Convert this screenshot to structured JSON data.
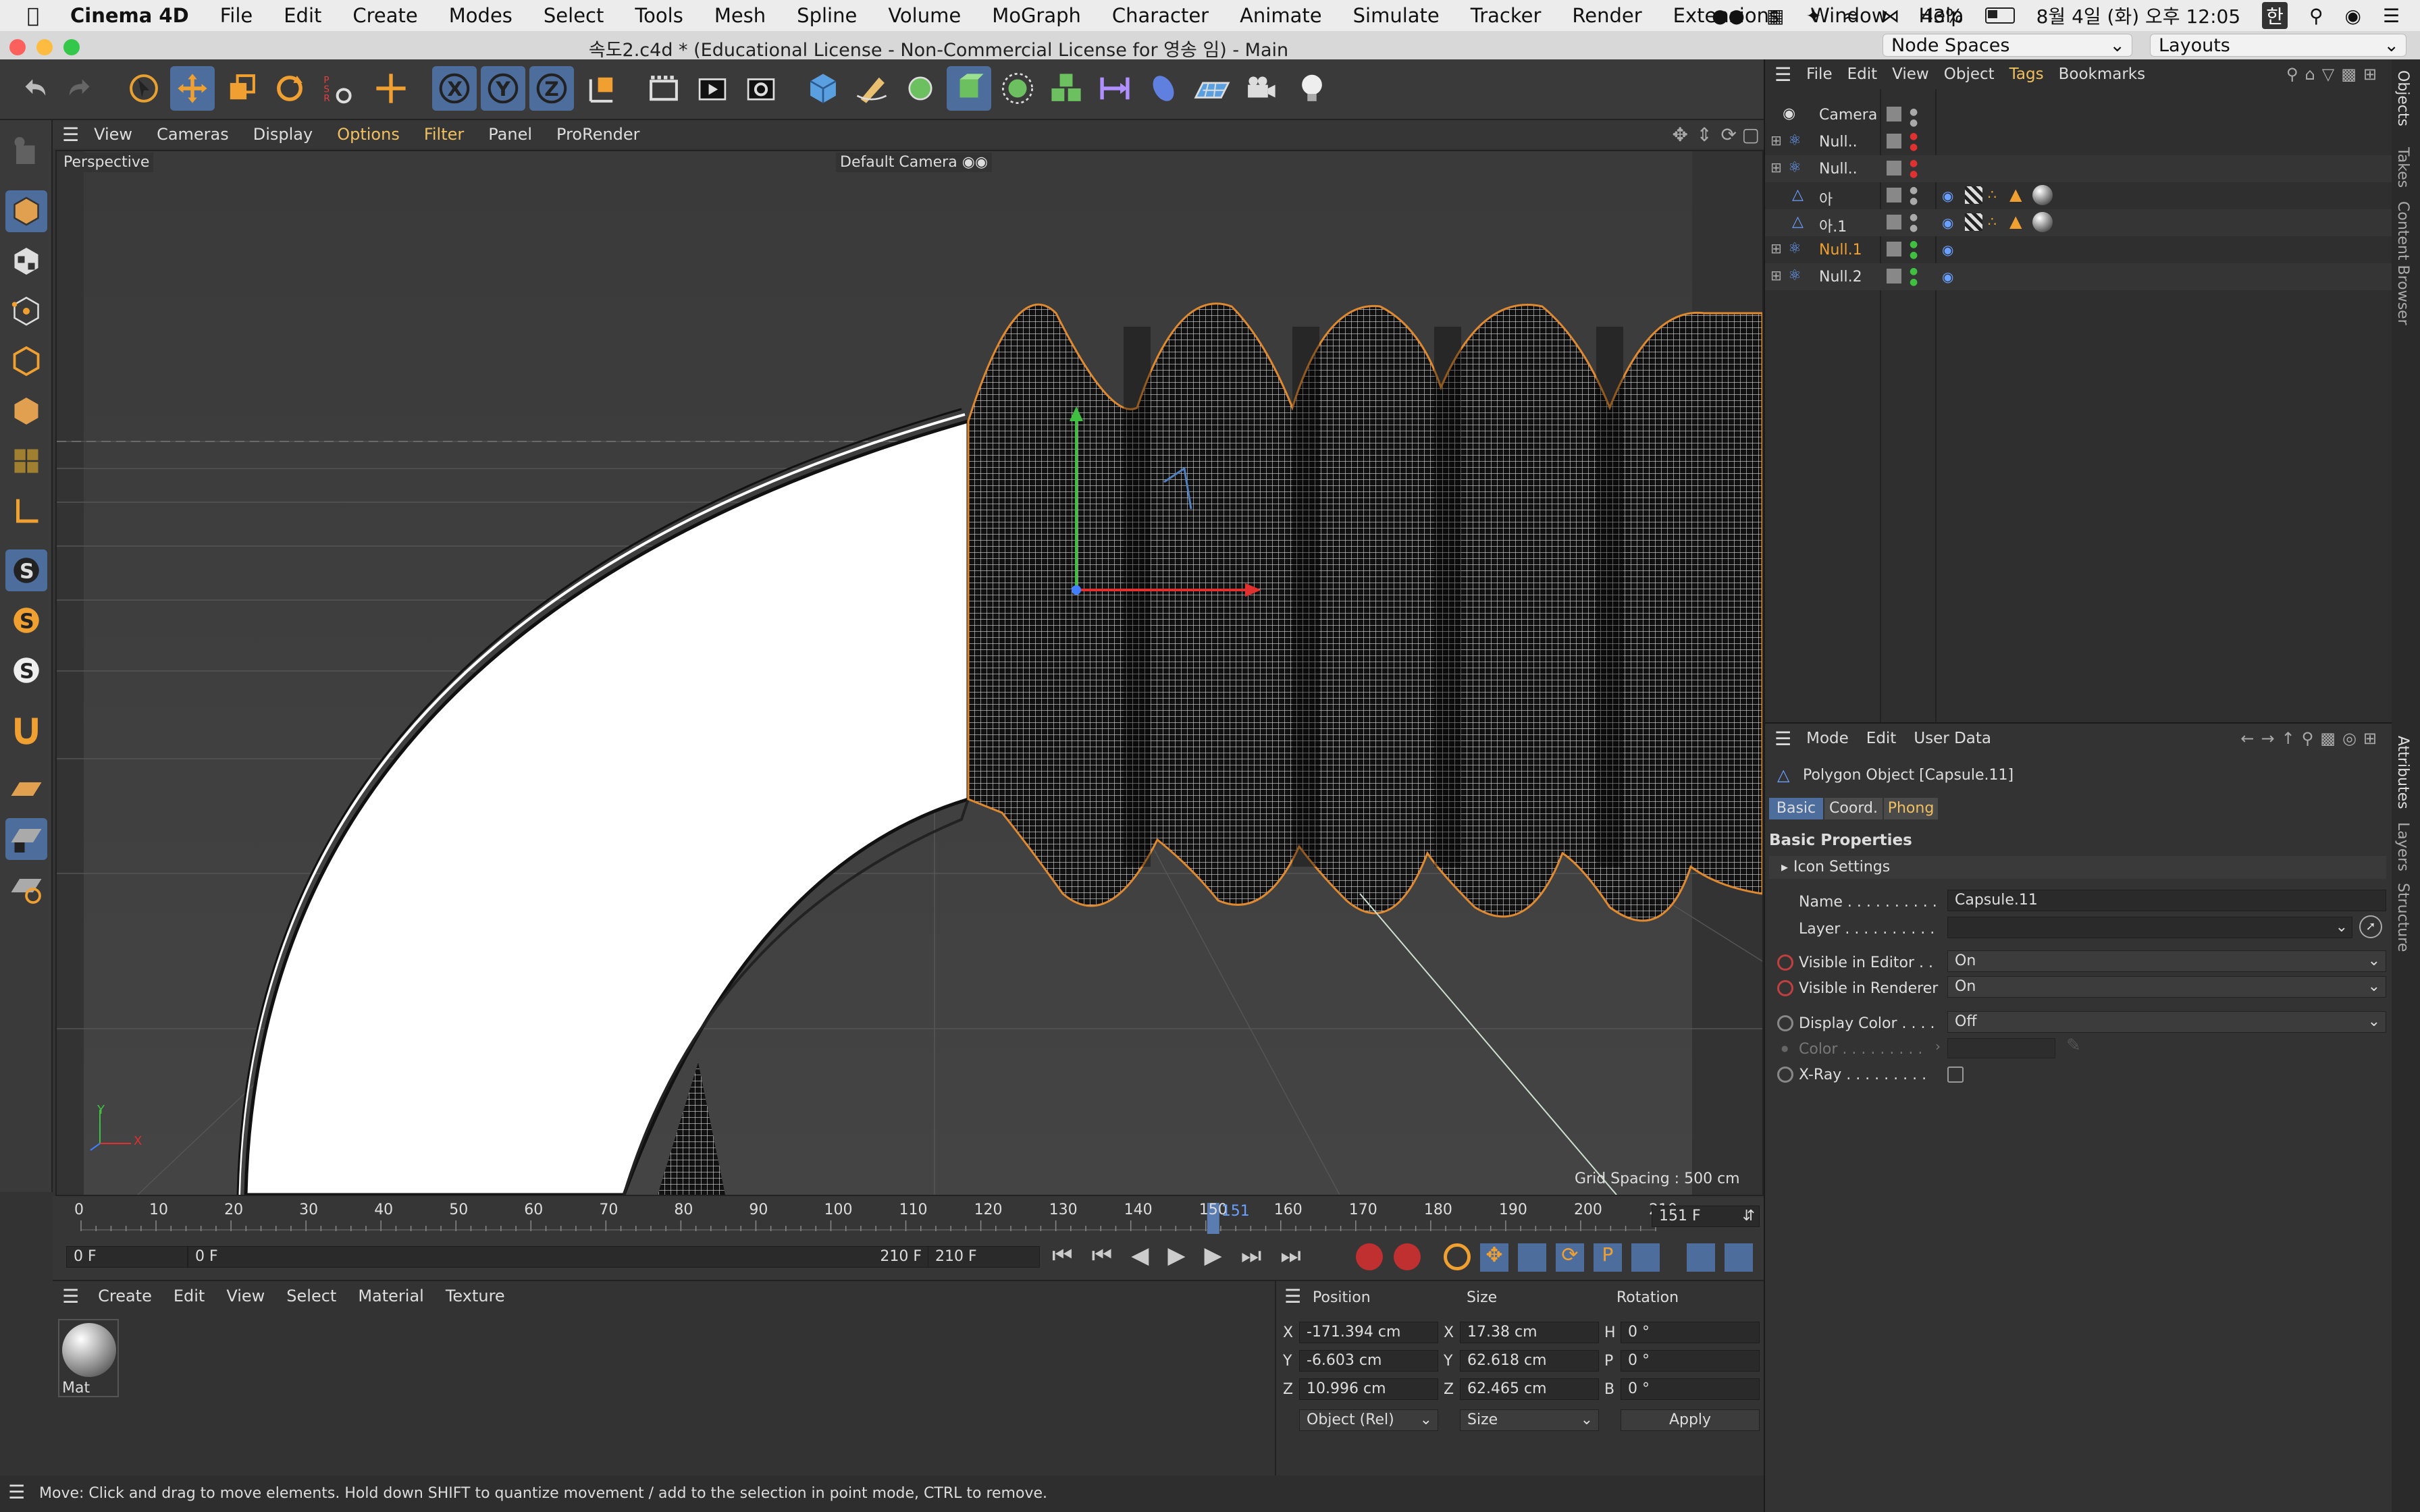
{
  "menubar": {
    "apple": "",
    "app": "Cinema 4D",
    "items": [
      "File",
      "Edit",
      "Create",
      "Modes",
      "Select",
      "Tools",
      "Mesh",
      "Spline",
      "Volume",
      "MoGraph",
      "Character",
      "Animate",
      "Simulate",
      "Tracker",
      "Render",
      "Extensions",
      "Window",
      "Help"
    ],
    "battery": "43%",
    "clock": "8월 4일 (화) 오후 12:05"
  },
  "window": {
    "title": "속도2.c4d * (Educational License - Non-Commercial License for 영송 임) - Main",
    "node_spaces": "Node Spaces",
    "layouts": "Layouts"
  },
  "viewport": {
    "menu": [
      "View",
      "Cameras",
      "Display",
      "Options",
      "Filter",
      "Panel",
      "ProRender"
    ],
    "perspective_label": "Perspective",
    "camera_label": "Default Camera",
    "grid_spacing": "Grid Spacing : 500 cm",
    "axis_y": "Y",
    "axis_x": "X"
  },
  "timeline": {
    "ticks": [
      "0",
      "10",
      "20",
      "30",
      "40",
      "50",
      "60",
      "70",
      "80",
      "90",
      "100",
      "110",
      "120",
      "130",
      "140",
      "150",
      "160",
      "170",
      "180",
      "190",
      "200",
      "210"
    ],
    "current_frame_marker": "151",
    "current_frame_field": "151 F",
    "start_field": "0 F",
    "start_field2": "0 F",
    "end_field": "210 F",
    "end_field2": "210 F",
    "current": 151,
    "max": 210
  },
  "material_manager": {
    "menu": [
      "Create",
      "Edit",
      "View",
      "Select",
      "Material",
      "Texture"
    ],
    "material_name": "Mat"
  },
  "coords": {
    "headers": [
      "Position",
      "Size",
      "Rotation"
    ],
    "rows": [
      {
        "axis": "X",
        "pos": "-171.394 cm",
        "saxis": "X",
        "size": "17.38 cm",
        "raxis": "H",
        "rot": "0 °"
      },
      {
        "axis": "Y",
        "pos": "-6.603 cm",
        "saxis": "Y",
        "size": "62.618 cm",
        "raxis": "P",
        "rot": "0 °"
      },
      {
        "axis": "Z",
        "pos": "10.996 cm",
        "saxis": "Z",
        "size": "62.465 cm",
        "raxis": "B",
        "rot": "0 °"
      }
    ],
    "mode_select": "Object (Rel)",
    "size_select": "Size",
    "apply": "Apply"
  },
  "status": "Move: Click and drag to move elements. Hold down SHIFT to quantize movement / add to the selection in point mode, CTRL to remove.",
  "object_manager": {
    "menu": [
      "File",
      "Edit",
      "View",
      "Object",
      "Tags",
      "Bookmarks"
    ],
    "objects": [
      {
        "name": "Camera",
        "color": "#dddddd"
      },
      {
        "name": "Null..",
        "color": "#dddddd"
      },
      {
        "name": "Null..",
        "color": "#dddddd"
      },
      {
        "name": "아",
        "color": "#dddddd"
      },
      {
        "name": "아.1",
        "color": "#dddddd"
      },
      {
        "name": "Null.1",
        "color": "#f0a030"
      },
      {
        "name": "Null.2",
        "color": "#dddddd"
      }
    ]
  },
  "attributes": {
    "menu": [
      "Mode",
      "Edit",
      "User Data"
    ],
    "object_title": "Polygon Object [Capsule.11]",
    "tabs": [
      "Basic",
      "Coord.",
      "Phong"
    ],
    "section": "Basic Properties",
    "icon_settings": "Icon Settings",
    "name_label": "Name . . . . . . . . . .",
    "name_value": "Capsule.11",
    "layer_label": "Layer . . . . . . . . . .",
    "vis_editor_label": "Visible in Editor . .",
    "vis_editor_value": "On",
    "vis_render_label": "Visible in Renderer",
    "vis_render_value": "On",
    "display_color_label": "Display Color . . . .",
    "display_color_value": "Off",
    "color_label": "Color . . . . . . . . .",
    "xray_label": "X-Ray . . . . . . . . ."
  },
  "side_tabs": [
    "Objects",
    "Takes",
    "Content Browser",
    "Attributes",
    "Layers",
    "Structure"
  ],
  "colors": {
    "accent": "#4d6e9c",
    "highlight": "#f0c060",
    "active_object": "#f0a030"
  }
}
